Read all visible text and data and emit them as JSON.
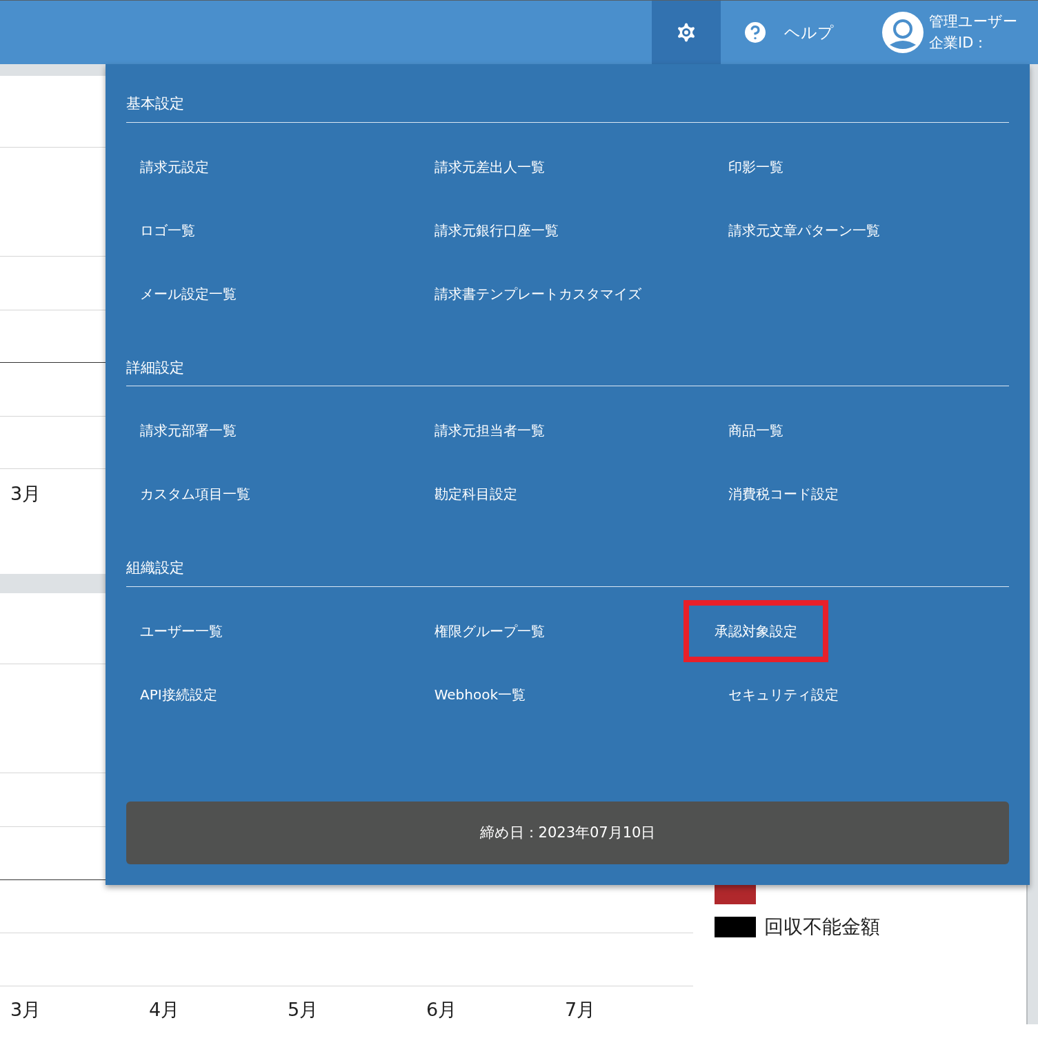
{
  "header": {
    "settings_selected": true,
    "help": "ヘルプ",
    "user_name": "管理ユーザー",
    "company_id": "企業ID："
  },
  "background": {
    "panel_1_label": "3月",
    "x_axis_labels": [
      "3月",
      "4月",
      "5月",
      "6月",
      "7月"
    ],
    "legend": [
      {
        "color": "#b0282c"
      },
      {
        "label": "回収不能金額",
        "color": "#000000"
      }
    ]
  },
  "settings_menu": {
    "sections": [
      {
        "title": "基本設定",
        "items": [
          {
            "label": "請求元設定",
            "highlighted": false
          },
          {
            "label": "請求元差出人一覧",
            "highlighted": false
          },
          {
            "label": "印影一覧",
            "highlighted": false
          },
          {
            "label": "ロゴ一覧",
            "highlighted": false
          },
          {
            "label": "請求元銀行口座一覧",
            "highlighted": false
          },
          {
            "label": "請求元文章パターン一覧",
            "highlighted": false
          },
          {
            "label": "メール設定一覧",
            "highlighted": false
          },
          {
            "label": "請求書テンプレートカスタマイズ",
            "highlighted": false
          }
        ]
      },
      {
        "title": "詳細設定",
        "items": [
          {
            "label": "請求元部署一覧",
            "highlighted": false
          },
          {
            "label": "請求元担当者一覧",
            "highlighted": false
          },
          {
            "label": "商品一覧",
            "highlighted": false
          },
          {
            "label": "カスタム項目一覧",
            "highlighted": false
          },
          {
            "label": "勘定科目設定",
            "highlighted": false
          },
          {
            "label": "消費税コード設定",
            "highlighted": false
          }
        ]
      },
      {
        "title": "組織設定",
        "items": [
          {
            "label": "ユーザー一覧",
            "highlighted": false
          },
          {
            "label": "権限グループ一覧",
            "highlighted": false
          },
          {
            "label": "承認対象設定",
            "highlighted": true
          },
          {
            "label": "API接続設定",
            "highlighted": false
          },
          {
            "label": "Webhook一覧",
            "highlighted": false
          },
          {
            "label": "セキュリティ設定",
            "highlighted": false
          }
        ]
      }
    ],
    "closing_date": "締め日：2023年07月10日"
  }
}
